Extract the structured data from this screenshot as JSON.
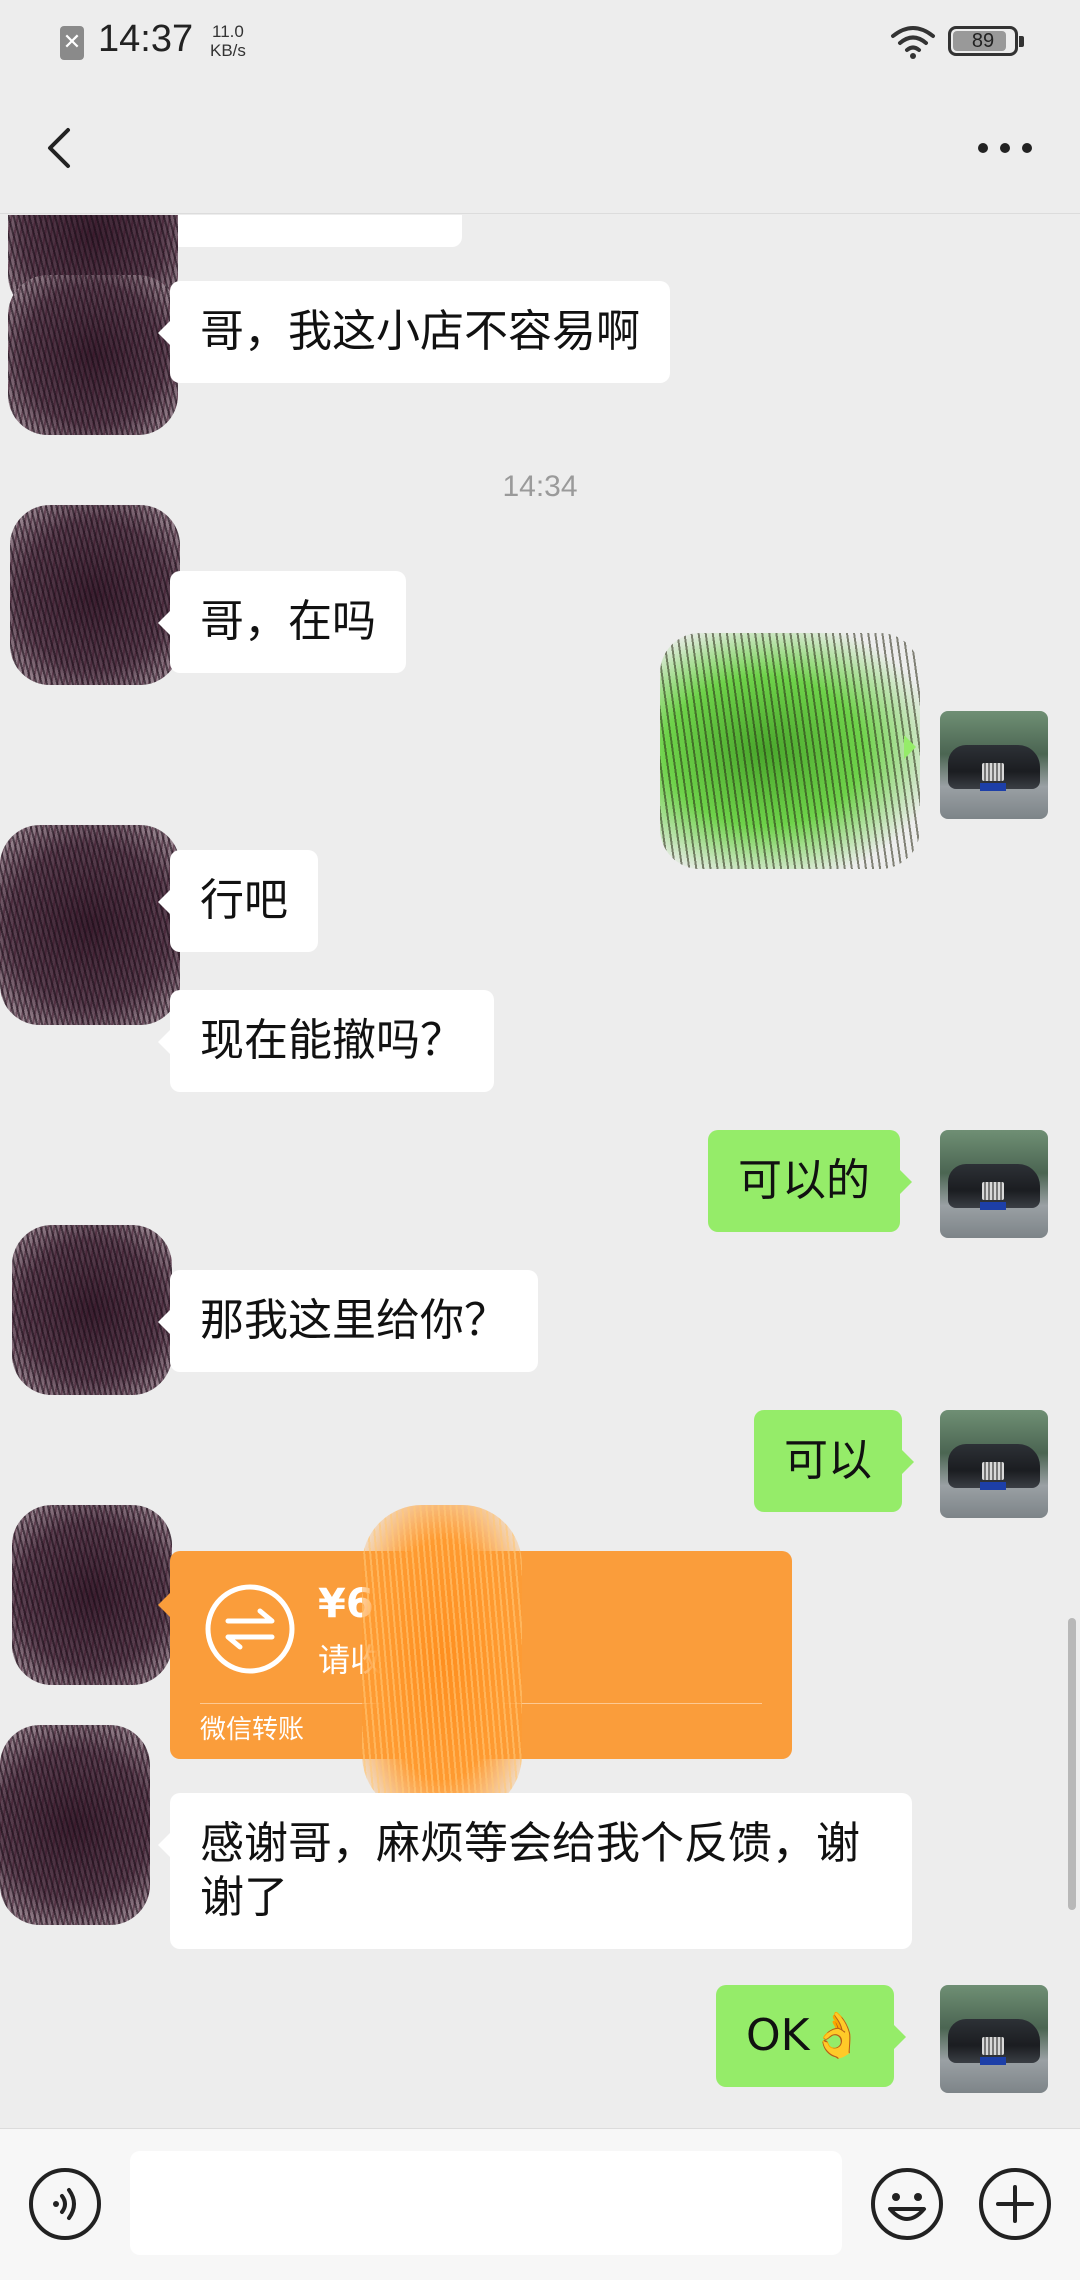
{
  "status_bar": {
    "close_glyph": "✕",
    "time": "14:37",
    "net_speed_value": "11.0",
    "net_speed_unit": "KB/s",
    "battery_level": "89"
  },
  "title_bar": {
    "back_icon": "chevron-left-icon",
    "more_icon": "more-dots-icon"
  },
  "messages": [
    {
      "side": "in",
      "text": "哥，我这小店不容易啊"
    },
    {
      "side": "in",
      "text": "哥，在吗"
    },
    {
      "side": "in",
      "text": "行吧"
    },
    {
      "side": "in",
      "text": "现在能撤吗？"
    },
    {
      "side": "out",
      "text": "可以的"
    },
    {
      "side": "in",
      "text": "那我这里给你？"
    },
    {
      "side": "out",
      "text": "可以"
    },
    {
      "side": "in",
      "text": "感谢哥，麻烦等会给我个反馈，谢谢了"
    },
    {
      "side": "out",
      "text": "OK👌"
    }
  ],
  "timestamp": "14:34",
  "transfer": {
    "amount": "¥6",
    "status": "请收",
    "footer": "微信转账",
    "color": "#fa9d3b"
  },
  "input_bar": {
    "voice_icon": "voice-icon",
    "emoji_icon": "emoji-icon",
    "plus_icon": "plus-icon",
    "text_value": ""
  },
  "colors": {
    "background": "#ededed",
    "outgoing_bubble": "#95ec69",
    "incoming_bubble": "#ffffff"
  }
}
